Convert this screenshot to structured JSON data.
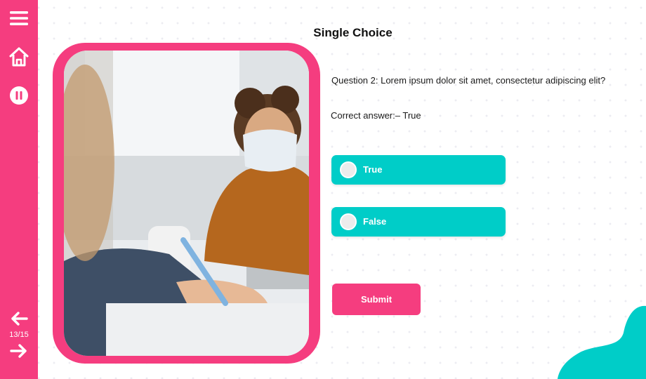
{
  "app": {
    "title": "Single Choice",
    "accent_color": "#f53d7f",
    "option_color": "#00cdc8"
  },
  "sidebar": {
    "icons": [
      "menu-icon",
      "home-icon",
      "pause-icon",
      "arrow-left-icon",
      "arrow-right-icon"
    ],
    "page_counter": "13/15"
  },
  "question": {
    "text": "Question 2: Lorem ipsum dolor sit amet, consectetur adipiscing elit?",
    "answer_label": "Correct answer:– ",
    "answer_value": "True"
  },
  "options": [
    {
      "label": "True"
    },
    {
      "label": "False"
    }
  ],
  "actions": {
    "submit_label": "Submit"
  }
}
